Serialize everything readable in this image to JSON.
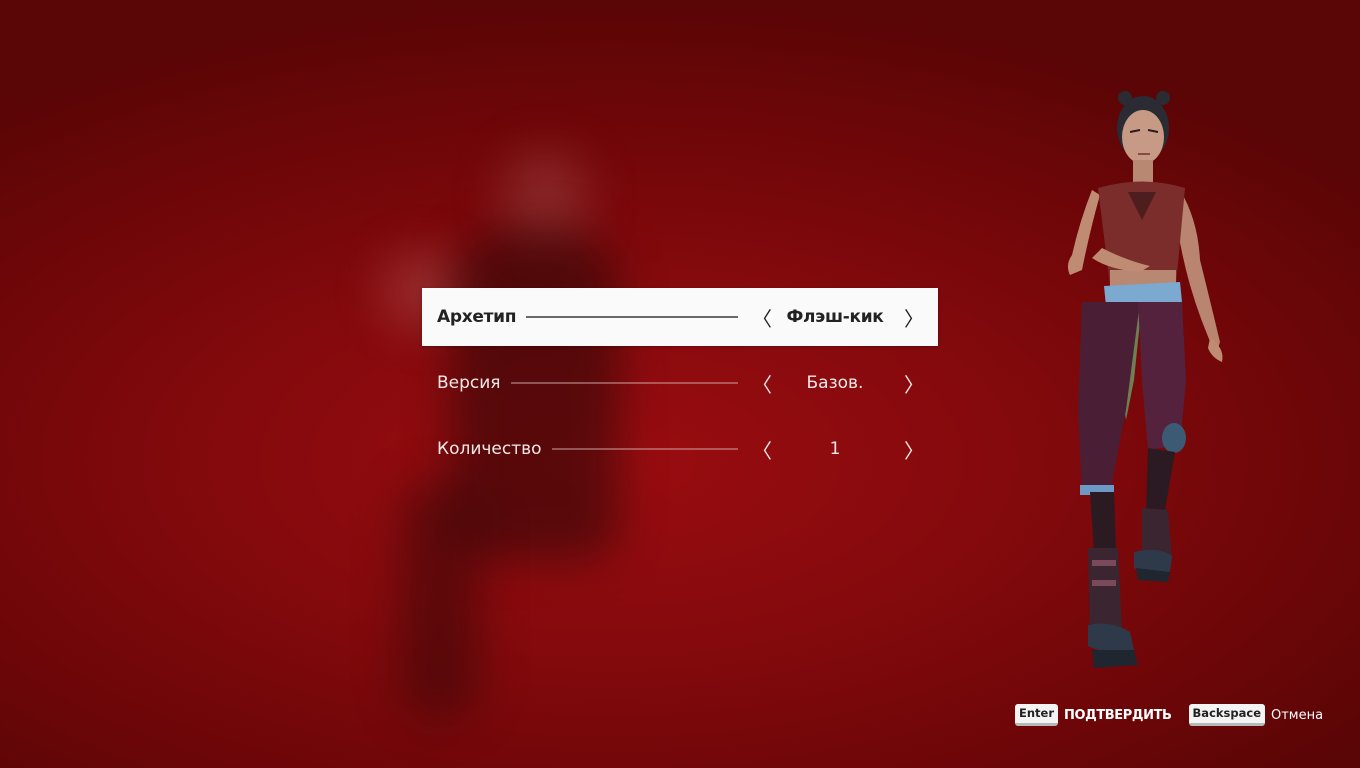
{
  "menu": {
    "rows": [
      {
        "label": "Архетип",
        "value": "Флэш-кик",
        "selected": true
      },
      {
        "label": "Версия",
        "value": "Базов.",
        "selected": false
      },
      {
        "label": "Количество",
        "value": "1",
        "selected": false
      }
    ],
    "arrow_left": "〈",
    "arrow_right": "〉"
  },
  "hints": {
    "confirm": {
      "key": "Enter",
      "label": "ПОДТВЕРДИТЬ"
    },
    "cancel": {
      "key": "Backspace",
      "label": "Отмена"
    }
  },
  "colors": {
    "background": "#850a0d",
    "selected_row": "#fafafa",
    "text_light": "#f2e8e8",
    "text_dark": "#222222"
  }
}
